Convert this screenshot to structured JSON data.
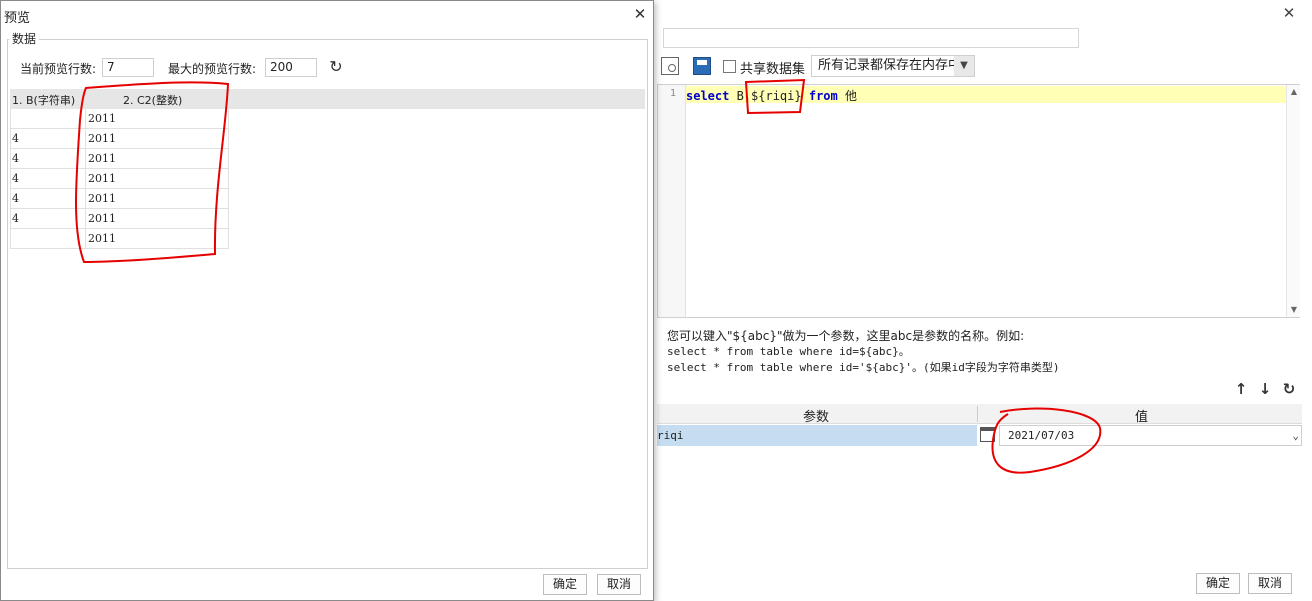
{
  "preview_dialog": {
    "title": "预览",
    "group_label": "数据",
    "current_rows_label": "当前预览行数:",
    "current_rows_value": "7",
    "max_rows_label": "最大的预览行数:",
    "max_rows_value": "200",
    "columns": [
      "1. B(字符串)",
      "2. C2(整数)"
    ],
    "rows": [
      [
        "",
        "2011"
      ],
      [
        "4",
        "2011"
      ],
      [
        "4",
        "2011"
      ],
      [
        "4",
        "2011"
      ],
      [
        "4",
        "2011"
      ],
      [
        "4",
        "2011"
      ],
      [
        "",
        "2011"
      ]
    ],
    "ok_label": "确定",
    "cancel_label": "取消"
  },
  "dataset_dialog": {
    "share_label": "共享数据集",
    "storage_option": "所有记录都保存在内存中",
    "sql": {
      "line_number": "1",
      "text_select": "select",
      "text_mid": " B,${riqi} ",
      "text_from": "from",
      "text_end": " 他"
    },
    "help_lines": [
      "您可以键入\"${abc}\"做为一个参数，这里abc是参数的名称。例如:",
      "select * from table where id=${abc}。",
      "select * from table where id='${abc}'。(如果id字段为字符串类型)"
    ],
    "param_header": "参数",
    "value_header": "值",
    "param_name": "riqi",
    "param_value": "2021/07/03",
    "ok_label": "确定",
    "cancel_label": "取消"
  }
}
